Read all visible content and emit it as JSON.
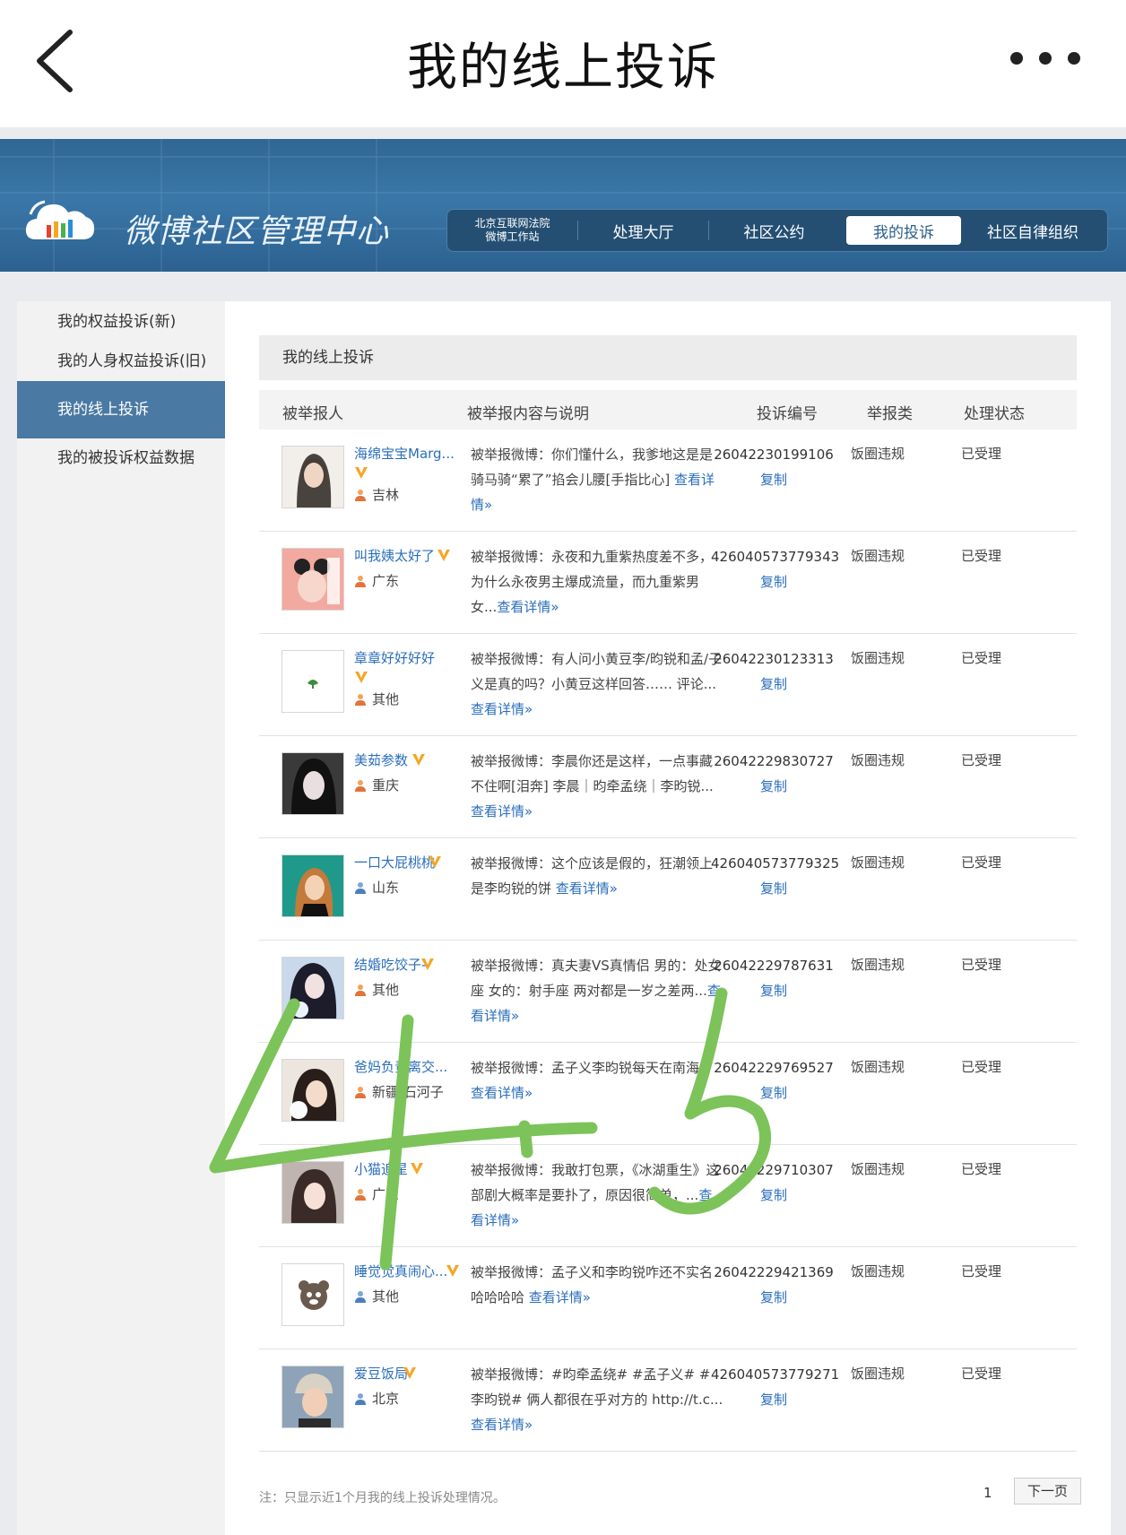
{
  "topbar": {
    "title": "我的线上投诉"
  },
  "banner": {
    "site_title": "微博社区管理中心",
    "nav": {
      "court_line1": "北京互联网法院",
      "court_line2": "微博工作站",
      "hall": "处理大厅",
      "convention": "社区公约",
      "my_complaints": "我的投诉",
      "self_discipline": "社区自律组织"
    }
  },
  "sidebar": {
    "items": [
      {
        "label": "我的权益投诉(新)"
      },
      {
        "label": "我的人身权益投诉(旧)"
      },
      {
        "label": "我的线上投诉"
      },
      {
        "label": "我的被投诉权益数据"
      }
    ]
  },
  "content": {
    "title": "我的线上投诉",
    "columns": [
      "被举报人",
      "被举报内容与说明",
      "投诉编号",
      "举报类",
      "处理状态"
    ],
    "copy_label": "复制",
    "rows": [
      {
        "name": "海绵宝宝Marg...",
        "location": "吉林",
        "desc": "被举报微博：你们懂什么，我爹地这是是骑马骑“累了”掐会儿腰[手指比心] ",
        "more": "查看详情»",
        "id": "26042230199106",
        "type": "饭圈违规",
        "status": "已受理"
      },
      {
        "name": "叫我姨太好了",
        "location": "广东",
        "desc": "被举报微博：永夜和九重紫热度差不多，为什么永夜男主爆成流量，而九重紫男女...",
        "more": "查看详情»",
        "id": "426040573779343",
        "type": "饭圈违规",
        "status": "已受理"
      },
      {
        "name": "章章好好好好",
        "location": "其他",
        "desc": "被举报微博：有人问小黄豆李/昀锐和孟/子义是真的吗？小黄豆这样回答…… 评论...",
        "more": "查看详情»",
        "id": "26042230123313",
        "type": "饭圈违规",
        "status": "已受理"
      },
      {
        "name": "美茹参数",
        "location": "重庆",
        "desc": "被举报微博：李晨你还是这样，一点事藏不住啊[泪奔] 李晨｜昀牵孟绕｜李昀锐...",
        "more": "查看详情»",
        "id": "26042229830727",
        "type": "饭圈违规",
        "status": "已受理"
      },
      {
        "name": "一口大屁桃桃",
        "location": "山东",
        "desc": "被举报微博：这个应该是假的，狂潮领上是李昀锐的饼 ",
        "more": "查看详情»",
        "id": "426040573779325",
        "type": "饭圈违规",
        "status": "已受理"
      },
      {
        "name": "结婚吃饺子-",
        "location": "其他",
        "desc": "被举报微博：真夫妻VS真情侣 男的：处女座 女的：射手座 两对都是一岁之差两...",
        "more": "查看详情»",
        "id": "26042229787631",
        "type": "饭圈违规",
        "status": "已受理"
      },
      {
        "name": "爸妈负责离交...",
        "location": "新疆 石河子",
        "desc": "被举报微博：孟子义李昀锐每天在南海：",
        "more": "查看详情»",
        "id": "26042229769527",
        "type": "饭圈违规",
        "status": "已受理"
      },
      {
        "name": "小猫追星",
        "location": "广东",
        "desc": "被举报微博：我敢打包票，《冰湖重生》这部剧大概率是要扑了，原因很简单，...",
        "more": "查看详情»",
        "id": "26042229710307",
        "type": "饭圈违规",
        "status": "已受理"
      },
      {
        "name": "睡觉觉真闹心...",
        "location": "其他",
        "desc": "被举报微博：孟子义和李昀锐咋还不实名哈哈哈哈 ",
        "more": "查看详情»",
        "id": "26042229421369",
        "type": "饭圈违规",
        "status": "已受理"
      },
      {
        "name": "爱豆饭局",
        "location": "北京",
        "desc": "被举报微博：#昀牵孟绕# #孟子义# #李昀锐# 俩人都很在乎对方的 http://t.c...",
        "more": "查看详情»",
        "id": "426040573779271",
        "type": "饭圈违规",
        "status": "已受理"
      }
    ]
  },
  "footer": {
    "note": "注：只显示近1个月我的线上投诉处理情况。",
    "page": "1",
    "next": "下一页"
  },
  "colors": {
    "banner": "#3a77a8",
    "link": "#2a6ebb",
    "active_side": "#4a79a3",
    "vip_badge": "#f5a623",
    "handwriting": "#7cc35a"
  }
}
